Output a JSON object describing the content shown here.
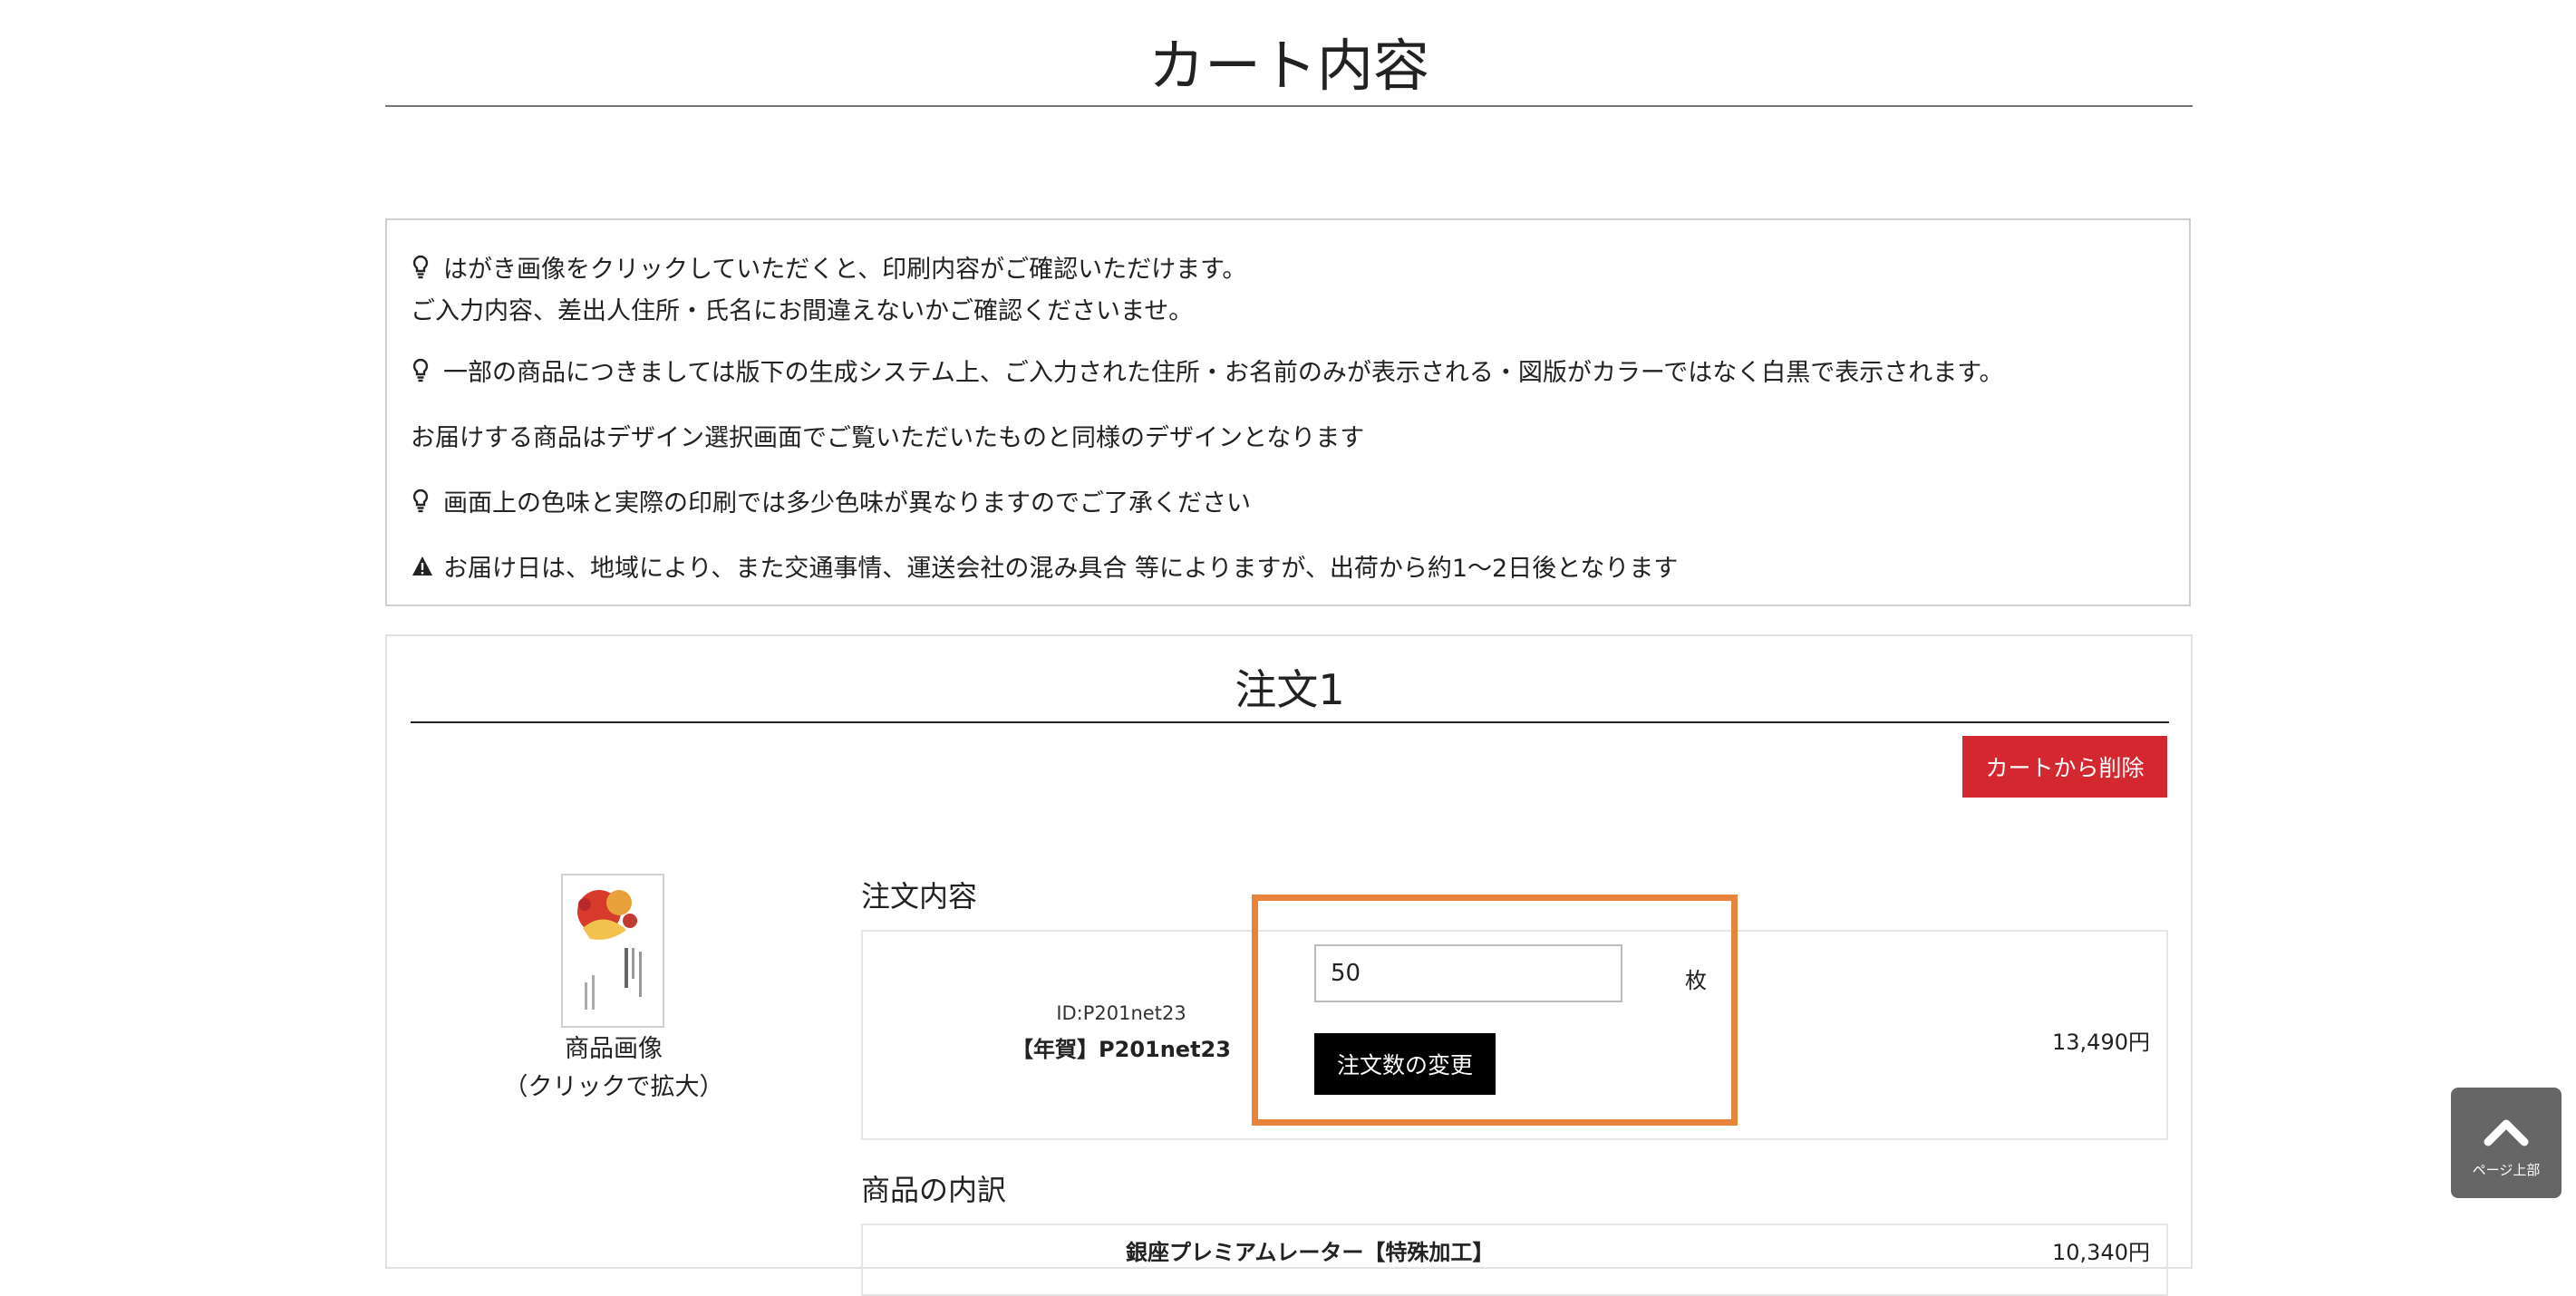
{
  "page": {
    "title": "カート内容"
  },
  "notice": {
    "items": [
      {
        "icon": "lightbulb-icon",
        "lines": [
          "はがき画像をクリックしていただくと、印刷内容がご確認いただけます。",
          "ご入力内容、差出人住所・氏名にお間違えないかご確認くださいませ。"
        ]
      },
      {
        "icon": "lightbulb-icon",
        "lines": [
          "一部の商品につきましては版下の生成システム上、ご入力された住所・お名前のみが表示される・図版がカラーではなく白黒で表示されます。"
        ]
      },
      {
        "icon": "",
        "lines": [
          "お届けする商品はデザイン選択画面でご覧いただいたものと同様のデザインとなります"
        ]
      },
      {
        "icon": "lightbulb-icon",
        "lines": [
          "画面上の色味と実際の印刷では多少色味が異なりますのでご了承ください"
        ]
      },
      {
        "icon": "warning-icon",
        "lines": [
          "お届け日は、地域により、また交通事情、運送会社の混み具合 等によりますが、出荷から約1～2日後となります"
        ]
      }
    ]
  },
  "order": {
    "title": "注文1",
    "delete_label": "カートから削除",
    "thumbnail_caption_1": "商品画像",
    "thumbnail_caption_2": "（クリックで拡大）",
    "details_heading": "注文内容",
    "product_id": "ID:P201net23",
    "product_name": "【年賀】P201net23",
    "quantity_value": "50",
    "quantity_unit": "枚",
    "change_label": "注文数の変更",
    "price": "13,490円",
    "breakdown_heading": "商品の内訳",
    "breakdown_item_name": "銀座プレミアムレーター【特殊加工】",
    "breakdown_item_price": "10,340円"
  },
  "scroll_top": {
    "label": "ページ上部"
  },
  "colors": {
    "delete": "#d3282f",
    "highlight": "#e8833a",
    "button_dark": "#000000"
  }
}
